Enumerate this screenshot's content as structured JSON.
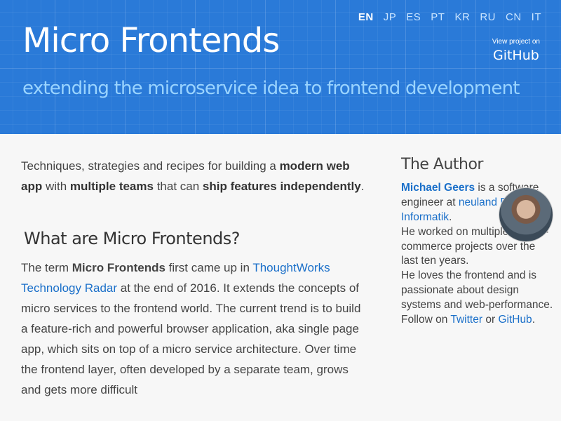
{
  "header": {
    "title": "Micro Frontends",
    "subtitle": "extending the microservice idea to frontend development",
    "languages": [
      "EN",
      "JP",
      "ES",
      "PT",
      "KR",
      "RU",
      "CN",
      "IT"
    ],
    "active_language": "EN",
    "github": {
      "small": "View project on",
      "big": "GitHub"
    }
  },
  "intro": {
    "p1": "Techniques, strategies and recipes for building a ",
    "b1": "modern web app",
    "p2": " with ",
    "b2": "multiple teams",
    "p3": " that can ",
    "b3": "ship features independently",
    "p4": "."
  },
  "section": {
    "heading": "What are Micro Frontends?",
    "t1": "The term ",
    "b1": "Micro Frontends",
    "t2": " first came up in ",
    "link": "ThoughtWorks Technology Radar",
    "t3": " at the end of 2016. It extends the concepts of micro services to the frontend world. The current trend is to build a feature-rich and powerful browser application, aka single page app, which sits on top of a micro service architecture. Over time the frontend layer, often developed by a separate team, grows and gets more difficult"
  },
  "sidebar": {
    "heading": "The Author",
    "name": "Michael Geers",
    "t1": " is a software engineer at ",
    "company": "neuland Büro für Informatik",
    "t2": ".",
    "line2": "He worked on multiple large e-commerce projects over the last ten years.",
    "line3": "He loves the frontend and is passionate about design systems and web-performance.",
    "follow": "Follow on ",
    "twitter": "Twitter",
    "or": " or ",
    "github": "GitHub",
    "end": "."
  }
}
